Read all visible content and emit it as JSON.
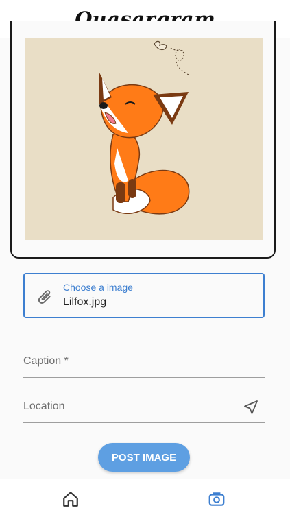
{
  "app": {
    "title": "Quasargram"
  },
  "photo": {
    "subject": "fox-illustration"
  },
  "upload": {
    "label": "Choose a image",
    "value": "Lilfox.jpg"
  },
  "form": {
    "caption_label": "Caption *",
    "location_label": "Location",
    "post_button": "POST IMAGE"
  },
  "nav": {
    "items": [
      "home-icon",
      "camera-icon"
    ],
    "active": "camera-icon"
  },
  "colors": {
    "accent": "#3d7fd0",
    "button": "#5e9fe2",
    "photo_bg": "#e9dec6"
  }
}
